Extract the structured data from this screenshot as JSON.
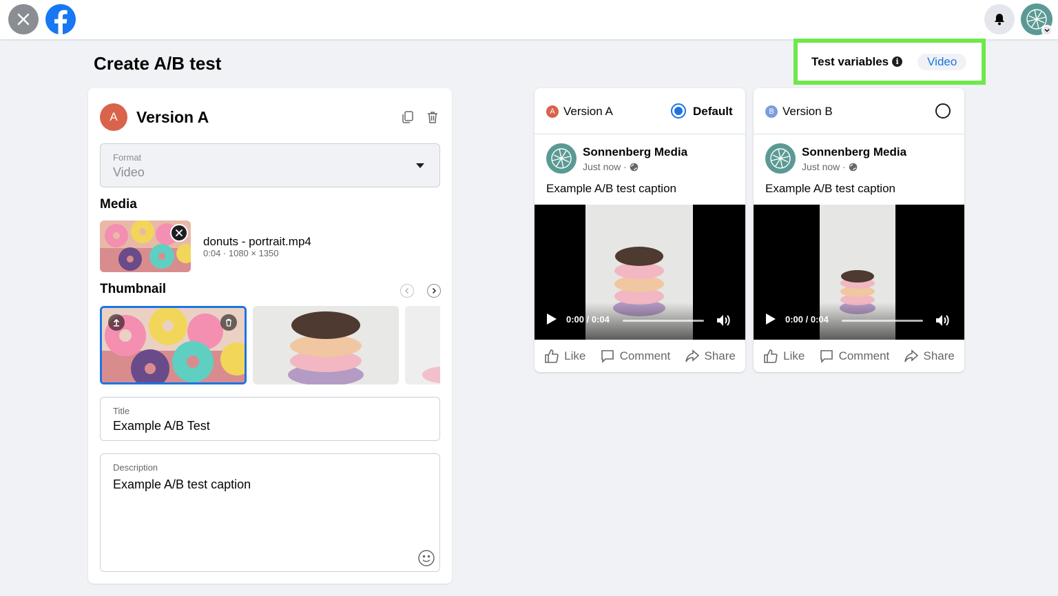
{
  "header": {
    "close_icon": "close-icon",
    "logo_icon": "facebook-logo",
    "bell_icon": "bell-icon",
    "profile_icon": "profile-avatar"
  },
  "page_title": "Create A/B test",
  "test_variables": {
    "label": "Test variables",
    "info_glyph": "i",
    "value": "Video"
  },
  "editor": {
    "avatar_letter": "A",
    "title": "Version A",
    "format": {
      "label": "Format",
      "value": "Video"
    },
    "media": {
      "section_title": "Media",
      "file_name": "donuts - portrait.mp4",
      "file_meta": "0:04 · 1080 × 1350"
    },
    "thumbnail": {
      "section_title": "Thumbnail"
    },
    "title_field": {
      "label": "Title",
      "value": "Example A/B Test"
    },
    "description_field": {
      "label": "Description",
      "value": "Example A/B test caption"
    }
  },
  "previews": [
    {
      "letter": "A",
      "version_label": "Version A",
      "default_label": "Default",
      "selected": true,
      "badge_color": "#d9634b",
      "page_name": "Sonnenberg Media",
      "time": "Just now ·",
      "caption": "Example A/B test caption",
      "video_time": "0:00 / 0:04",
      "actions": {
        "like": "Like",
        "comment": "Comment",
        "share": "Share"
      }
    },
    {
      "letter": "B",
      "version_label": "Version B",
      "default_label": "",
      "selected": false,
      "badge_color": "#7b9de0",
      "page_name": "Sonnenberg Media",
      "time": "Just now ·",
      "caption": "Example A/B test caption",
      "video_time": "0:00 / 0:04",
      "actions": {
        "like": "Like",
        "comment": "Comment",
        "share": "Share"
      }
    }
  ],
  "colors": {
    "accent": "#1b74e4",
    "highlight": "#6ee84a",
    "page_bg": "#f0f2f5"
  }
}
